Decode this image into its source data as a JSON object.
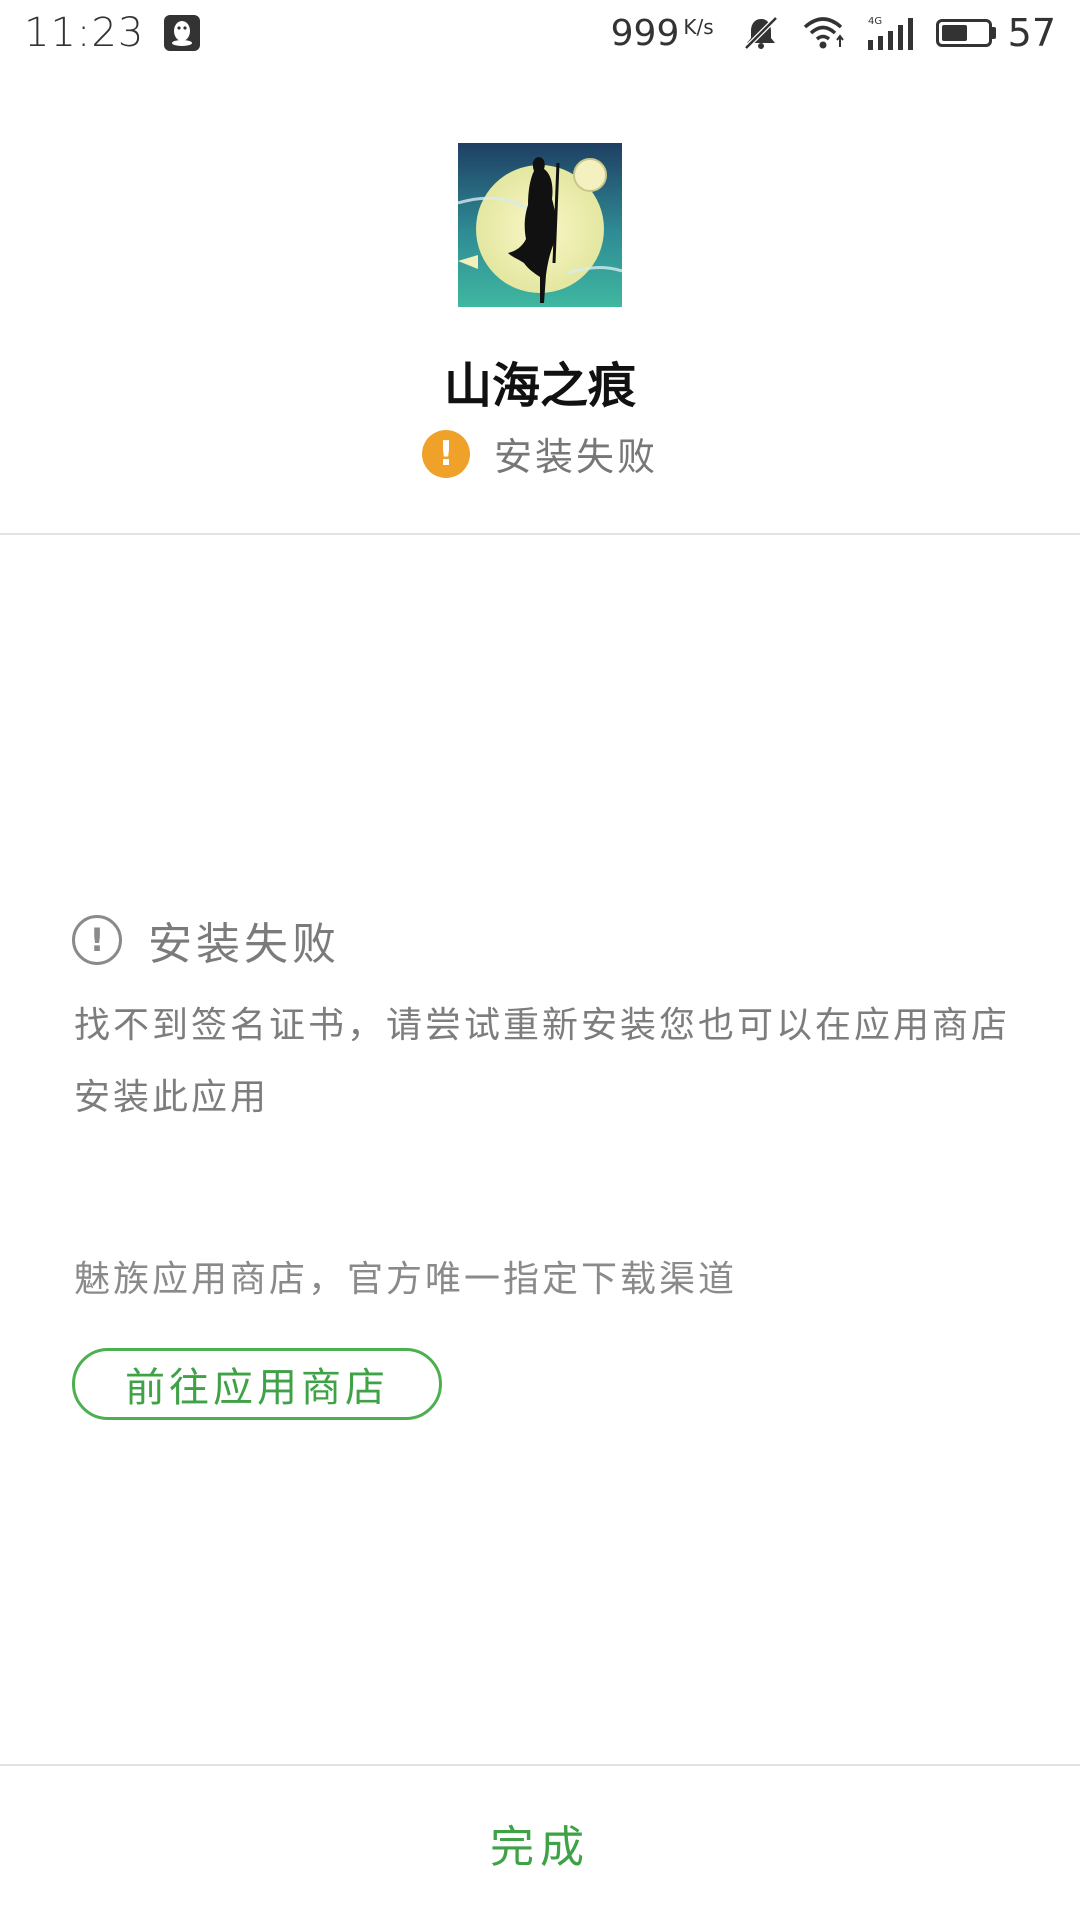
{
  "status_bar": {
    "time": "11:23",
    "network_speed": "999",
    "network_speed_unit": "K/s",
    "network_type": "4G",
    "battery_level": 57,
    "battery_text": "57",
    "icons": [
      "qq-notification-icon",
      "silent-bell-icon",
      "wifi-icon",
      "cellular-signal-icon",
      "battery-icon"
    ]
  },
  "app": {
    "name": "山海之痕",
    "status_text": "安装失败",
    "status_color": "#f0a12a"
  },
  "error": {
    "title": "安装失败",
    "message": "找不到签名证书，请尝试重新安装您也可以在应用商店安装此应用"
  },
  "store": {
    "note": "魅族应用商店，官方唯一指定下载渠道",
    "button_label": "前往应用商店"
  },
  "footer": {
    "done_label": "完成"
  },
  "colors": {
    "accent_green": "#3fa246",
    "warning_orange": "#f0a12a",
    "text_gray": "#7d7d7d",
    "divider": "#e2e2e2"
  }
}
